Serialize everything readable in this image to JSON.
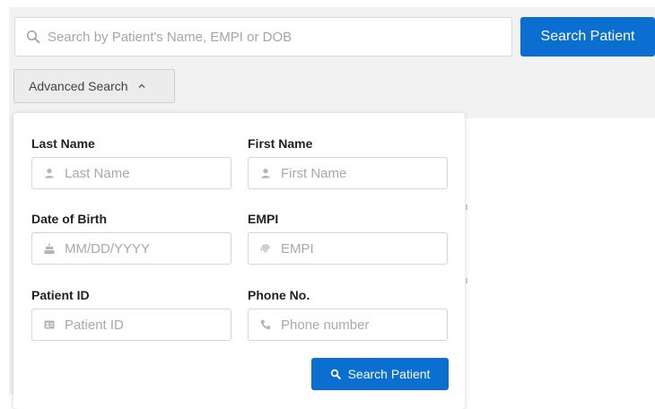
{
  "search": {
    "placeholder": "Search by Patient's Name, EMPI or DOB",
    "button_label": "Search Patient"
  },
  "advanced": {
    "toggle_label": "Advanced Search",
    "fields": {
      "last_name": {
        "label": "Last Name",
        "placeholder": "Last Name",
        "icon": "user-icon"
      },
      "first_name": {
        "label": "First Name",
        "placeholder": "First Name",
        "icon": "user-icon"
      },
      "dob": {
        "label": "Date of Birth",
        "placeholder": "MM/DD/YYYY",
        "icon": "cake-icon"
      },
      "empi": {
        "label": "EMPI",
        "placeholder": "EMPI",
        "icon": "fingerprint-icon"
      },
      "patient_id": {
        "label": "Patient ID",
        "placeholder": "Patient ID",
        "icon": "id-card-icon"
      },
      "phone": {
        "label": "Phone No.",
        "placeholder": "Phone number",
        "icon": "phone-icon"
      }
    },
    "submit_label": "Search Patient"
  },
  "colors": {
    "primary": "#0a6fd0",
    "background_band": "#f2f2f2",
    "placeholder": "#a9a9a9"
  }
}
